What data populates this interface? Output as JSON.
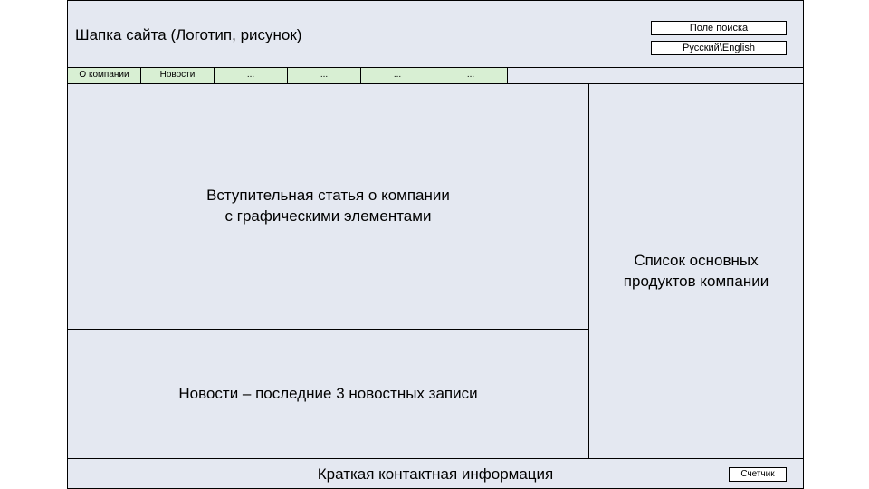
{
  "header": {
    "title": "Шапка сайта (Логотип, рисунок)",
    "search": "Поле поиска",
    "lang": "Русский\\English"
  },
  "nav": {
    "items": [
      "О компании",
      "Новости",
      "...",
      "...",
      "...",
      "..."
    ]
  },
  "main": {
    "intro_line1": "Вступительная статья о компании",
    "intro_line2": "с графическими элементами",
    "news": "Новости – последние 3 новостных записи",
    "products_line1": "Список основных",
    "products_line2": "продуктов компании"
  },
  "footer": {
    "contact": "Краткая контактная информация",
    "counter": "Счетчик"
  }
}
